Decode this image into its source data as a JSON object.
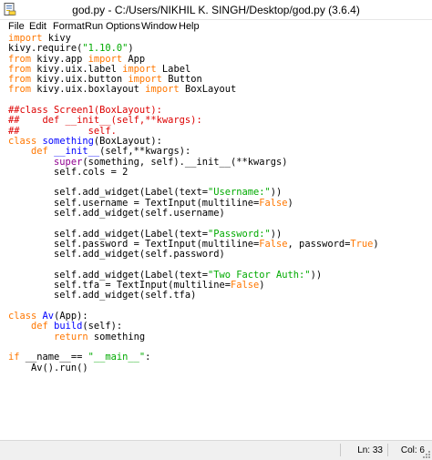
{
  "window": {
    "title": "god.py - C:/Users/NIKHIL K. SINGH/Desktop/god.py (3.6.4)",
    "app_icon": "python-idle-file-icon"
  },
  "menu": [
    "File",
    "Edit",
    "Format",
    "Run",
    "Options",
    "Window",
    "Help"
  ],
  "colors": {
    "keyword": "#ff7700",
    "string": "#00aa00",
    "definition": "#0000ff",
    "builtin": "#900090",
    "comment": "#dd0000"
  },
  "code_lines": [
    [
      [
        "kw",
        "import"
      ],
      [
        "plain",
        " kivy"
      ]
    ],
    [
      [
        "plain",
        "kivy.require("
      ],
      [
        "str",
        "\"1.10.0\""
      ],
      [
        "plain",
        ")"
      ]
    ],
    [
      [
        "kw",
        "from"
      ],
      [
        "plain",
        " kivy.app "
      ],
      [
        "kw",
        "import"
      ],
      [
        "plain",
        " App"
      ]
    ],
    [
      [
        "kw",
        "from"
      ],
      [
        "plain",
        " kivy.uix.label "
      ],
      [
        "kw",
        "import"
      ],
      [
        "plain",
        " Label"
      ]
    ],
    [
      [
        "kw",
        "from"
      ],
      [
        "plain",
        " kivy.uix.button "
      ],
      [
        "kw",
        "import"
      ],
      [
        "plain",
        " Button"
      ]
    ],
    [
      [
        "kw",
        "from"
      ],
      [
        "plain",
        " kivy.uix.boxlayout "
      ],
      [
        "kw",
        "import"
      ],
      [
        "plain",
        " BoxLayout"
      ]
    ],
    [],
    [
      [
        "comment",
        "##class Screen1(BoxLayout):"
      ]
    ],
    [
      [
        "comment",
        "##    def __init__(self,**kwargs):"
      ]
    ],
    [
      [
        "comment",
        "##            self."
      ]
    ],
    [
      [
        "kw",
        "class"
      ],
      [
        "plain",
        " "
      ],
      [
        "def",
        "something"
      ],
      [
        "plain",
        "(BoxLayout):"
      ]
    ],
    [
      [
        "plain",
        "    "
      ],
      [
        "kw",
        "def"
      ],
      [
        "plain",
        " "
      ],
      [
        "def",
        "__init__"
      ],
      [
        "plain",
        "(self,**kwargs):"
      ]
    ],
    [
      [
        "plain",
        "        "
      ],
      [
        "builtin",
        "super"
      ],
      [
        "plain",
        "(something, self).__init__(**kwargs)"
      ]
    ],
    [
      [
        "plain",
        "        self.cols = 2"
      ]
    ],
    [],
    [
      [
        "plain",
        "        self.add_widget(Label(text="
      ],
      [
        "str",
        "\"Username:\""
      ],
      [
        "plain",
        "))"
      ]
    ],
    [
      [
        "plain",
        "        self.username = TextInput(multiline="
      ],
      [
        "kw",
        "False"
      ],
      [
        "plain",
        ")"
      ]
    ],
    [
      [
        "plain",
        "        self.add_widget(self.username)"
      ]
    ],
    [],
    [
      [
        "plain",
        "        self.add_widget(Label(text="
      ],
      [
        "str",
        "\"Password:\""
      ],
      [
        "plain",
        "))"
      ]
    ],
    [
      [
        "plain",
        "        self.password = TextInput(multiline="
      ],
      [
        "kw",
        "False"
      ],
      [
        "plain",
        ", password="
      ],
      [
        "kw",
        "True"
      ],
      [
        "plain",
        ")"
      ]
    ],
    [
      [
        "plain",
        "        self.add_widget(self.password)"
      ]
    ],
    [],
    [
      [
        "plain",
        "        self.add_widget(Label(text="
      ],
      [
        "str",
        "\"Two Factor Auth:\""
      ],
      [
        "plain",
        "))"
      ]
    ],
    [
      [
        "plain",
        "        self.tfa = TextInput(multiline="
      ],
      [
        "kw",
        "False"
      ],
      [
        "plain",
        ")"
      ]
    ],
    [
      [
        "plain",
        "        self.add_widget(self.tfa)"
      ]
    ],
    [],
    [
      [
        "kw",
        "class"
      ],
      [
        "plain",
        " "
      ],
      [
        "def",
        "Av"
      ],
      [
        "plain",
        "(App):"
      ]
    ],
    [
      [
        "plain",
        "    "
      ],
      [
        "kw",
        "def"
      ],
      [
        "plain",
        " "
      ],
      [
        "def",
        "build"
      ],
      [
        "plain",
        "(self):"
      ]
    ],
    [
      [
        "plain",
        "        "
      ],
      [
        "kw",
        "return"
      ],
      [
        "plain",
        " something"
      ]
    ],
    [],
    [
      [
        "kw",
        "if"
      ],
      [
        "plain",
        " __name__== "
      ],
      [
        "str",
        "\"__main__\""
      ],
      [
        "plain",
        ":"
      ]
    ],
    [
      [
        "plain",
        "    Av().run()"
      ]
    ]
  ],
  "status": {
    "line": "Ln: 33",
    "col": "Col: 6"
  }
}
